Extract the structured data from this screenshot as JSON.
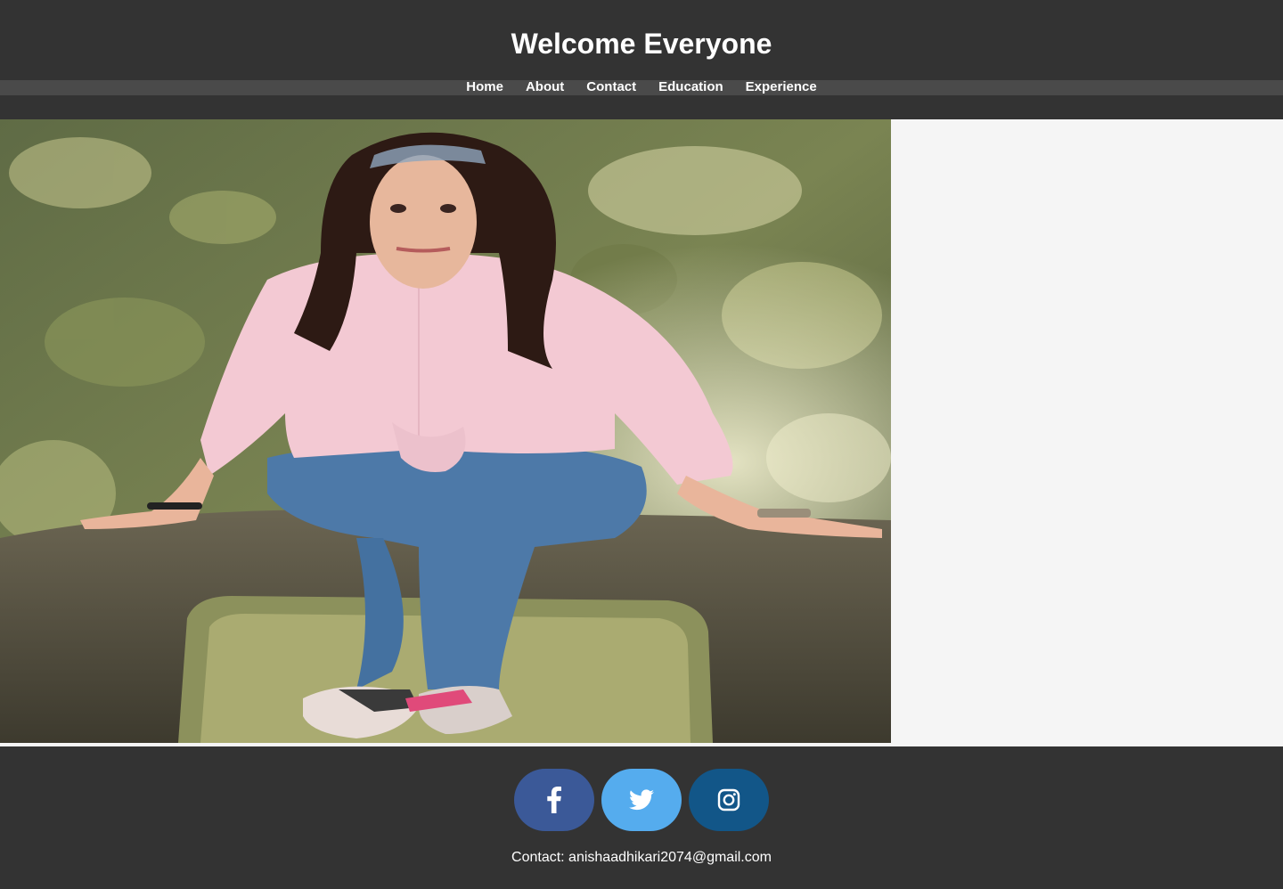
{
  "header": {
    "title": "Welcome Everyone"
  },
  "nav": {
    "items": [
      {
        "label": "Home"
      },
      {
        "label": "About"
      },
      {
        "label": "Contact"
      },
      {
        "label": "Education"
      },
      {
        "label": "Experience"
      }
    ]
  },
  "hero": {
    "image": "profile-photo"
  },
  "social": {
    "facebook": {
      "icon": "facebook-icon",
      "color": "#3b5998"
    },
    "twitter": {
      "icon": "twitter-icon",
      "color": "#55acee"
    },
    "instagram": {
      "icon": "instagram-icon",
      "color": "#125688"
    }
  },
  "footer": {
    "contact": "Contact: anishaadhikari2074@gmail.com"
  },
  "colors": {
    "background": "#333333",
    "navbar": "#4a4a4a",
    "content": "#f5f5f5"
  }
}
